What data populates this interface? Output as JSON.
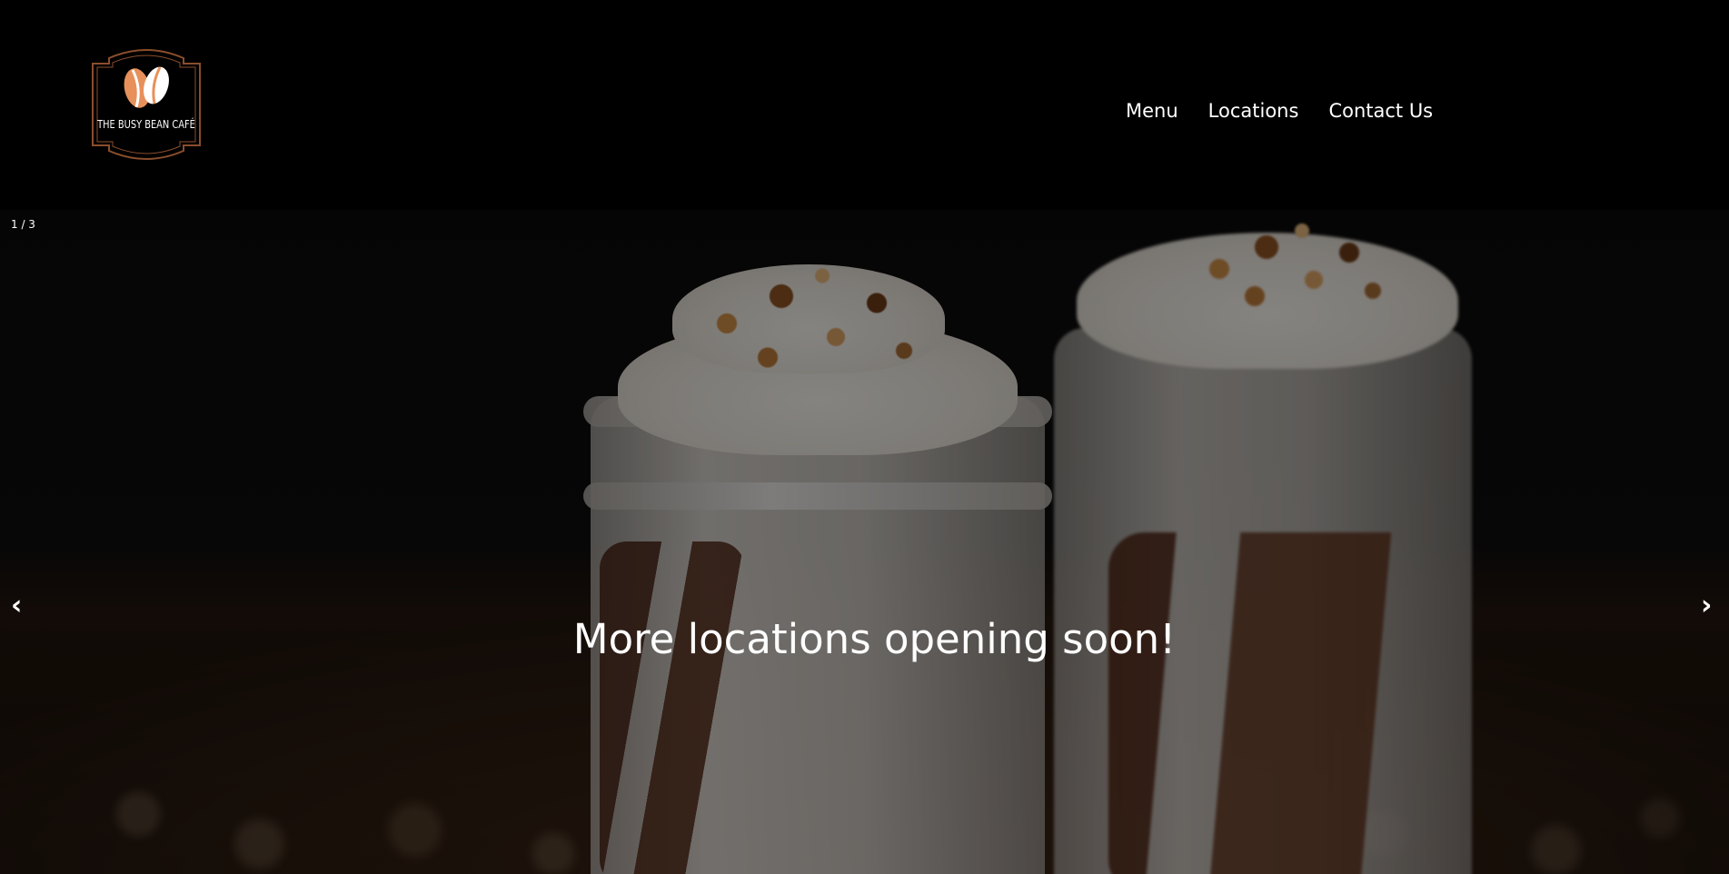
{
  "header": {
    "logo_text": "THE BUSY BEAN CAFÉ",
    "nav": [
      {
        "label": "Menu"
      },
      {
        "label": "Locations"
      },
      {
        "label": "Contact Us"
      }
    ]
  },
  "slideshow": {
    "counter": "1 / 3",
    "caption": "More locations opening soon!",
    "prev_label": "‹",
    "next_label": "›",
    "current_slide": 1,
    "total_slides": 3
  },
  "colors": {
    "background": "#000000",
    "text": "#ffffff",
    "logo_accent": "#e8905a",
    "logo_border": "#8a4e2c"
  },
  "icons": {
    "logo": "coffee-bean-logo-icon",
    "prev": "chevron-left-icon",
    "next": "chevron-right-icon"
  }
}
